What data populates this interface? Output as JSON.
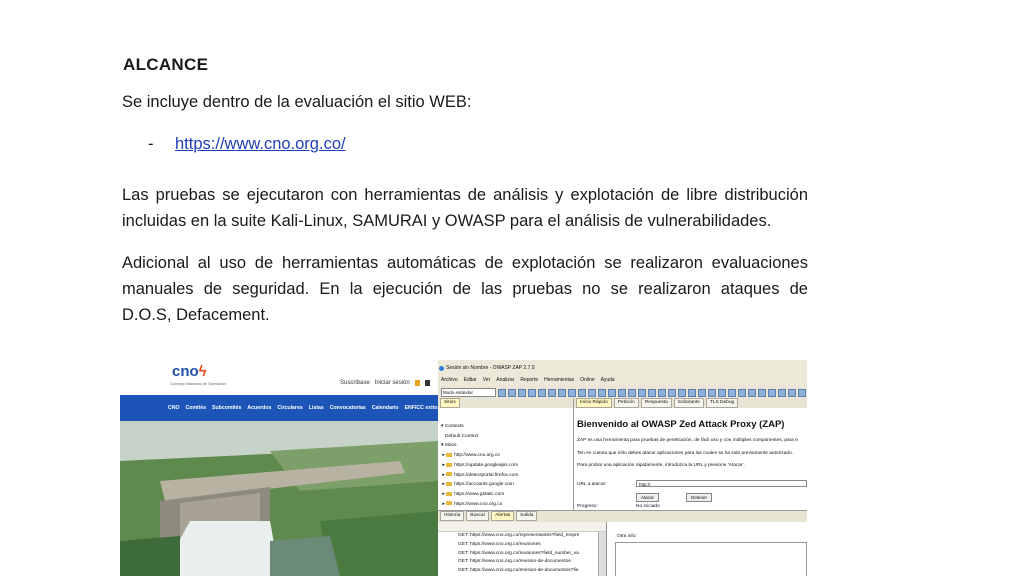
{
  "doc": {
    "heading": "ALCANCE",
    "intro": "Se incluye dentro de la evaluación el sitio WEB:",
    "bullet": "-",
    "link": "https://www.cno.org.co/",
    "p2_lines": [
      "Las pruebas se ejecutaron con herramientas de análisis y explotación de libre distribución",
      "incluidas en la suite Kali-Linux, SAMURAI y OWASP para el análisis de vulnerabilidades."
    ],
    "p3_lines": [
      "Adicional al uso de herramientas automáticas de explotación se realizaron evaluaciones",
      "manuales de seguridad. En la ejecución de las pruebas no se realizaron ataques de",
      "D.O.S, Defacement."
    ]
  },
  "cno": {
    "logo": "cno",
    "subtitle": "Consejo Nacional de Operación",
    "top_links": [
      "Suscribase",
      "Iniciar sesión"
    ],
    "nav": [
      "CNO",
      "Comités",
      "Subcomités",
      "Acuerdos",
      "Circulares",
      "Listas",
      "Convocatorias",
      "Calendario",
      "ENFICC exitosas"
    ]
  },
  "zap": {
    "title": "Sesión sin Nombre - OWASP ZAP 2.7.0",
    "menu": [
      "Archivo",
      "Editar",
      "Ver",
      "Analizar",
      "Reporte",
      "Herramientas",
      "Online",
      "Ayuda"
    ],
    "mode": "Modo estándar",
    "left_tabs": [
      "Sitios"
    ],
    "tree": [
      "Contexts",
      "Default Context",
      "Sitios",
      "http://www.cno.org.co",
      "https://update.googleapis.com",
      "https://detectportal.firefox.com",
      "https://accounts.google.com",
      "https://www.gstatic.com",
      "https://www.cno.org.co"
    ],
    "right_tabs": [
      "Inicio Rápido",
      "Petición",
      "Respuesta",
      "Solicitante",
      "TLS Debug"
    ],
    "welcome": "Bienvenido al OWASP Zed Attack Proxy (ZAP)",
    "body": [
      "ZAP es una herramienta para pruebas de penetración, de fácil uso y con múltiples componentes, para e",
      "Ten en cuenta que sólo debes atacar aplicaciones para las cuales se ha sido previamente autorizado.",
      "Para probar una aplicación rápidamente, introduzca la URL y presione 'Atacar'."
    ],
    "url_label": "URL a atacar:",
    "url_value": "http://",
    "attack_btn": "Atacar",
    "stop_btn": "Detener",
    "progress_label": "Progreso:",
    "progress_value": "No iniciado",
    "bottom_tabs": [
      "Historia",
      "Buscar",
      "Alertas",
      "Salida"
    ],
    "requests": [
      "GET: https://www.cno.org.co/representantes?field_empre",
      "GET: https://www.cno.org.co/reuniones",
      "GET: https://www.cno.org.co/reuniones?field_number_va",
      "GET: https://www.cno.org.co/revision-de-documentos",
      "GET: https://www.cno.org.co/revision-de-documentos?fie"
    ],
    "info_label": "Otra info:"
  }
}
